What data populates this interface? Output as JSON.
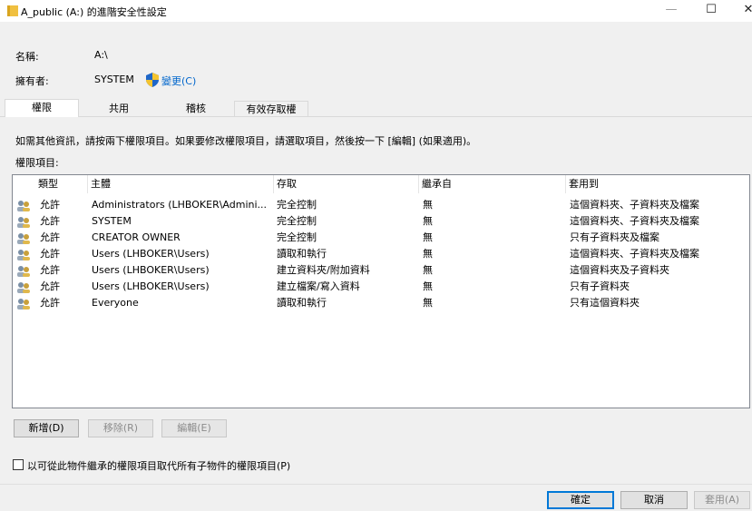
{
  "window": {
    "title": "A_public (A:) 的進階安全性設定",
    "controls": {
      "minimize": "—",
      "maximize": "☐",
      "close": "✕"
    }
  },
  "fields": {
    "name_label": "名稱:",
    "name_value": "A:\\",
    "owner_label": "擁有者:",
    "owner_value": "SYSTEM",
    "change_link": "變更(C)"
  },
  "tabs": [
    {
      "label": "權限",
      "active": true
    },
    {
      "label": "共用",
      "active": false
    },
    {
      "label": "稽核",
      "active": false
    },
    {
      "label": "有效存取權",
      "active": false
    }
  ],
  "info_text": "如需其他資訊，請按兩下權限項目。如果要修改權限項目，請選取項目，然後按一下 [編輯] (如果適用)。",
  "list_label": "權限項目:",
  "table": {
    "columns": [
      "類型",
      "主體",
      "存取",
      "繼承自",
      "套用到"
    ],
    "rows": [
      [
        "允許",
        "Administrators (LHBOKER\\Admini...",
        "完全控制",
        "無",
        "這個資料夾、子資料夾及檔案"
      ],
      [
        "允許",
        "SYSTEM",
        "完全控制",
        "無",
        "這個資料夾、子資料夾及檔案"
      ],
      [
        "允許",
        "CREATOR OWNER",
        "完全控制",
        "無",
        "只有子資料夾及檔案"
      ],
      [
        "允許",
        "Users (LHBOKER\\Users)",
        "讀取和執行",
        "無",
        "這個資料夾、子資料夾及檔案"
      ],
      [
        "允許",
        "Users (LHBOKER\\Users)",
        "建立資料夾/附加資料",
        "無",
        "這個資料夾及子資料夾"
      ],
      [
        "允許",
        "Users (LHBOKER\\Users)",
        "建立檔案/寫入資料",
        "無",
        "只有子資料夾"
      ],
      [
        "允許",
        "Everyone",
        "讀取和執行",
        "無",
        "只有這個資料夾"
      ]
    ]
  },
  "buttons": {
    "add": "新增(D)",
    "remove": "移除(R)",
    "edit": "編輯(E)",
    "ok": "確定",
    "cancel": "取消",
    "apply": "套用(A)"
  },
  "checkbox_label": "以可從此物件繼承的權限項目取代所有子物件的權限項目(P)",
  "icons": {
    "title": "folder-icon",
    "shield": "uac-shield-icon",
    "row": "user-group-icon"
  },
  "colors": {
    "link": "#0066cc",
    "default_button_border": "#0078d7",
    "folder": "#f0c040"
  }
}
